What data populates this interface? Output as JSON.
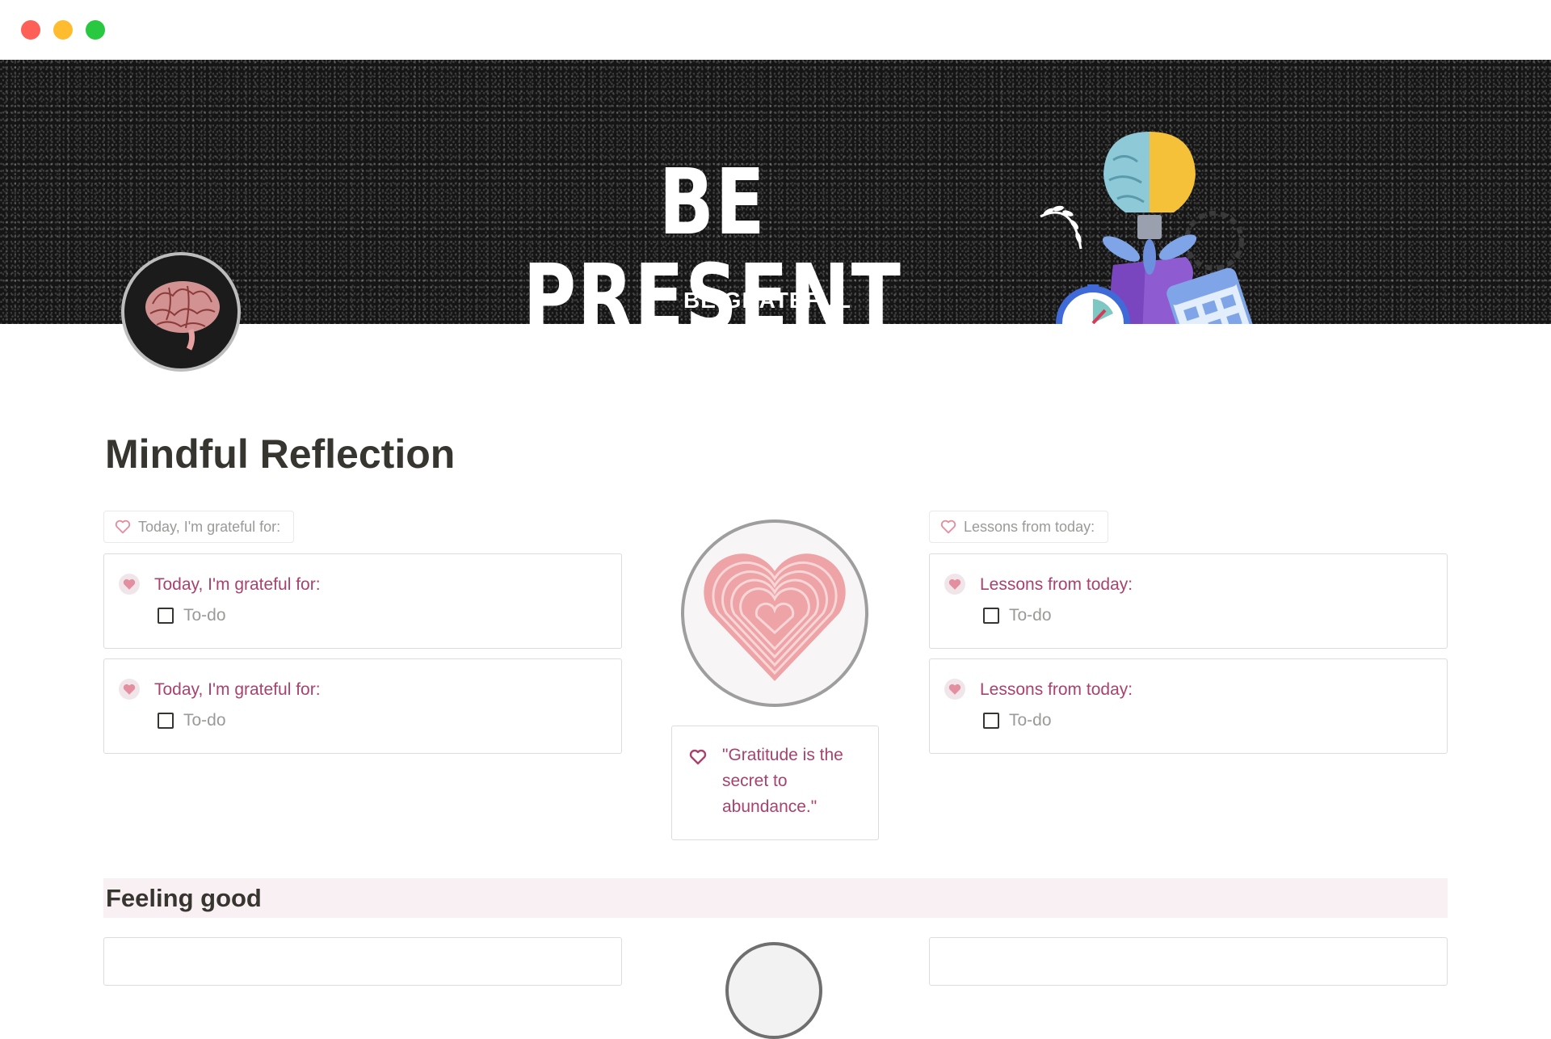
{
  "window": {
    "controls": [
      "close",
      "minimize",
      "zoom"
    ]
  },
  "cover": {
    "title": "BE PRESENT",
    "subtitle": "BE GRATEFUL"
  },
  "page": {
    "title": "Mindful Reflection"
  },
  "templates": {
    "grateful_label": "Today, I'm grateful for:",
    "lessons_label": "Lessons from today:"
  },
  "grateful_cards": [
    {
      "title": "Today, I'm grateful for:",
      "todo": "To-do"
    },
    {
      "title": "Today, I'm grateful for:",
      "todo": "To-do"
    }
  ],
  "lessons_cards": [
    {
      "title": "Lessons from today:",
      "todo": "To-do"
    },
    {
      "title": "Lessons from today:",
      "todo": "To-do"
    }
  ],
  "quote": {
    "text": "\"Gratitude is the secret to abundance.\""
  },
  "sections": {
    "feeling_good": "Feeling good"
  },
  "colors": {
    "accent_text": "#a8426e",
    "heart_pink": "#e48fa0",
    "section_bg": "#f8f0f2"
  }
}
